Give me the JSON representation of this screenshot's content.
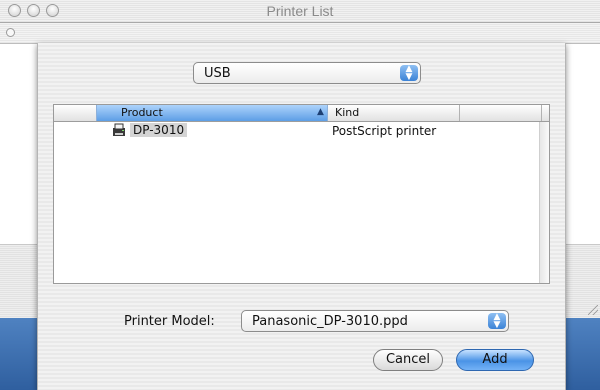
{
  "window": {
    "title": "Printer List"
  },
  "sheet": {
    "connection_popup": {
      "selected": "USB"
    },
    "table": {
      "columns": {
        "product": "Product",
        "kind": "Kind"
      },
      "sort_indicator": "▲",
      "rows": [
        {
          "product": "DP-3010",
          "kind": "PostScript printer",
          "icon": "printer-icon"
        }
      ]
    },
    "printer_model": {
      "label": "Printer Model:",
      "selected": "Panasonic_DP-3010.ppd"
    },
    "buttons": {
      "cancel": "Cancel",
      "add": "Add"
    },
    "popup_arrows": "▲\n▼"
  },
  "colors": {
    "accent": "#3b82d6",
    "selected_header": "#5d9ee6",
    "window_bg": "#dcdcdc"
  }
}
